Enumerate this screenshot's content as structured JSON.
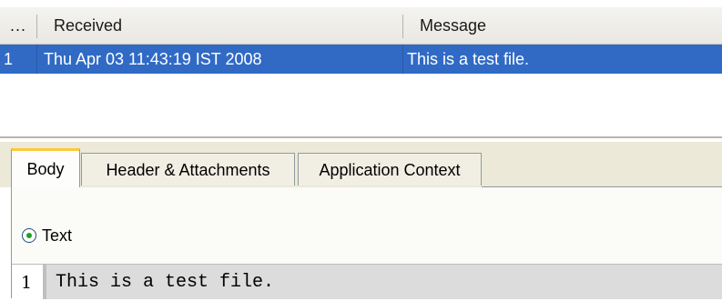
{
  "messages_table": {
    "columns": [
      "...",
      "Received",
      "Message"
    ],
    "rows": [
      {
        "index": "1",
        "received": "Thu Apr 03 11:43:19 IST 2008",
        "message": "This is a test file."
      }
    ],
    "selected_row": 0,
    "selection_color": "#316ac5"
  },
  "tabs": [
    {
      "label": "Body",
      "active": true
    },
    {
      "label": "Header & Attachments",
      "active": false
    },
    {
      "label": "Application Context",
      "active": false
    }
  ],
  "body_panel": {
    "format_option": {
      "label": "Text",
      "selected": true
    },
    "content_lines": [
      {
        "number": "1",
        "text": "This is a test file."
      }
    ]
  },
  "colors": {
    "active_tab_accent": "#ffc83c",
    "radio_dot": "#21a121"
  },
  "icons": {
    "radio": "radio-selected-icon"
  }
}
